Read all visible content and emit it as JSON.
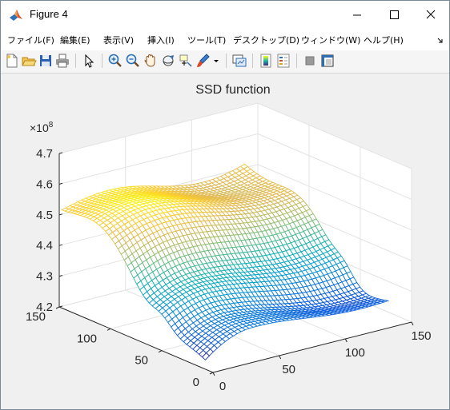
{
  "window": {
    "title": "Figure 4"
  },
  "menu": [
    {
      "label": "ファイル(F)"
    },
    {
      "label": "編集(E)"
    },
    {
      "label": "表示(V)"
    },
    {
      "label": "挿入(I)"
    },
    {
      "label": "ツール(T)"
    },
    {
      "label": "デスクトップ(D)"
    },
    {
      "label": "ウィンドウ(W)"
    },
    {
      "label": "ヘルプ(H)"
    }
  ],
  "menu_overflow_icon": "chevron-more-icon",
  "toolbar_icons": [
    "new-figure-icon",
    "open-file-icon",
    "save-icon",
    "print-icon",
    "pointer-icon",
    "zoom-in-icon",
    "zoom-out-icon",
    "pan-hand-icon",
    "rotate-3d-icon",
    "data-cursor-icon",
    "brush-icon",
    "brush-dropdown-icon",
    "link-plot-icon",
    "insert-colorbar-icon",
    "insert-legend-icon",
    "hide-plot-tools-icon",
    "show-plot-tools-icon"
  ],
  "chart_data": {
    "type": "surface-mesh",
    "title": "SSD function",
    "z_exponent_label": "×10",
    "z_exponent_power": "8",
    "z_ticks": [
      "4.2",
      "4.3",
      "4.4",
      "4.5",
      "4.6",
      "4.7"
    ],
    "z_range": [
      4.2,
      4.7
    ],
    "x_range": [
      0,
      150
    ],
    "y_range": [
      0,
      150
    ],
    "x_ticks": [
      "0",
      "50",
      "100",
      "150"
    ],
    "y_ticks": [
      "0",
      "50",
      "100",
      "150"
    ],
    "grid": true,
    "colormap": "parula",
    "xlabel": "",
    "ylabel": "",
    "zlabel": ""
  }
}
